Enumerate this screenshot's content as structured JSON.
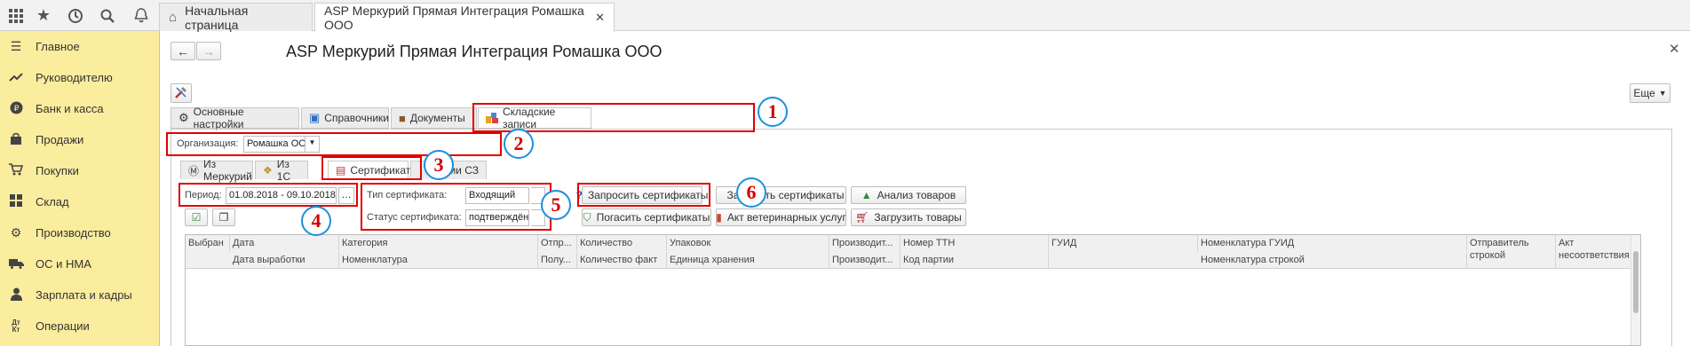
{
  "top_bar": {
    "icons": [
      "apps-grid-icon",
      "star-icon",
      "history-icon",
      "search-icon",
      "bell-icon"
    ],
    "tabs": [
      {
        "label": "Начальная страница"
      },
      {
        "label": "ASP Меркурий Прямая Интеграция Ромашка ООО"
      }
    ]
  },
  "sidebar": {
    "items": [
      {
        "label": "Главное",
        "icon": "menu-lines-icon"
      },
      {
        "label": "Руководителю",
        "icon": "trend-chart-icon"
      },
      {
        "label": "Банк и касса",
        "icon": "ruble-coin-icon"
      },
      {
        "label": "Продажи",
        "icon": "shopping-bag-icon"
      },
      {
        "label": "Покупки",
        "icon": "cart-icon"
      },
      {
        "label": "Склад",
        "icon": "warehouse-grid-icon"
      },
      {
        "label": "Производство",
        "icon": "factory-gear-icon"
      },
      {
        "label": "ОС и НМА",
        "icon": "truck-icon"
      },
      {
        "label": "Зарплата и кадры",
        "icon": "person-icon"
      },
      {
        "label": "Операции",
        "icon": "dt-kt-icon"
      }
    ]
  },
  "page": {
    "title": "ASP Меркурий Прямая Интеграция Ромашка ООО",
    "more_button": "Еще",
    "outer_tabs": [
      {
        "label": "Основные настройки",
        "icon": "gear-icon"
      },
      {
        "label": "Справочники",
        "icon": "reference-book-icon"
      },
      {
        "label": "Документы",
        "icon": "briefcase-icon"
      },
      {
        "label": "Складские записи",
        "icon": "warehouse-records-icon"
      }
    ],
    "organization": {
      "label": "Организация:",
      "value": "Ромашка ООО"
    },
    "inner_tabs": [
      {
        "label": "Из Меркурий",
        "icon": "mercury-icon"
      },
      {
        "label": "Из 1С",
        "icon": "onec-icon"
      },
      {
        "label": "Сертификаты",
        "icon": "certificate-icon"
      },
      {
        "label": "рсии СЗ",
        "icon": ""
      }
    ],
    "period": {
      "label": "Период:",
      "value": "01.08.2018 - 09.10.2018"
    },
    "cert_type": {
      "label": "Тип сертификата:",
      "value": "Входящий"
    },
    "cert_status": {
      "label": "Статус сертификата:",
      "value": "подтверждён"
    },
    "buttons": {
      "request_certs": "Запросить сертификаты",
      "load_certs": "Загрузить сертификаты",
      "analyze_goods": "Анализ товаров",
      "redeem_certs": "Погасить сертификаты",
      "vet_act": "Акт ветеринарных услуг",
      "load_goods": "Загрузить товары"
    },
    "markers": [
      "1",
      "2",
      "3",
      "4",
      "5",
      "6"
    ],
    "table": {
      "header_row1": [
        "Выбран",
        "Дата",
        "Категория",
        "Отпр...",
        "Количество",
        "Упаковок",
        "Производит...",
        "Номер ТТН",
        "ГУИД",
        "Номенклатура ГУИД",
        "Отправитель строкой",
        "Акт несоответствия"
      ],
      "header_row2": [
        "Дата выработки",
        "Номенклатура",
        "Полу...",
        "Количество факт",
        "Единица хранения",
        "Производит...",
        "Код партии",
        "Номенклатура строкой"
      ]
    }
  },
  "colors": {
    "sidebar": "#fbed9e",
    "highlight_box": "#e00000",
    "marker_border": "#1a8fe0",
    "marker_text": "#d40000"
  }
}
